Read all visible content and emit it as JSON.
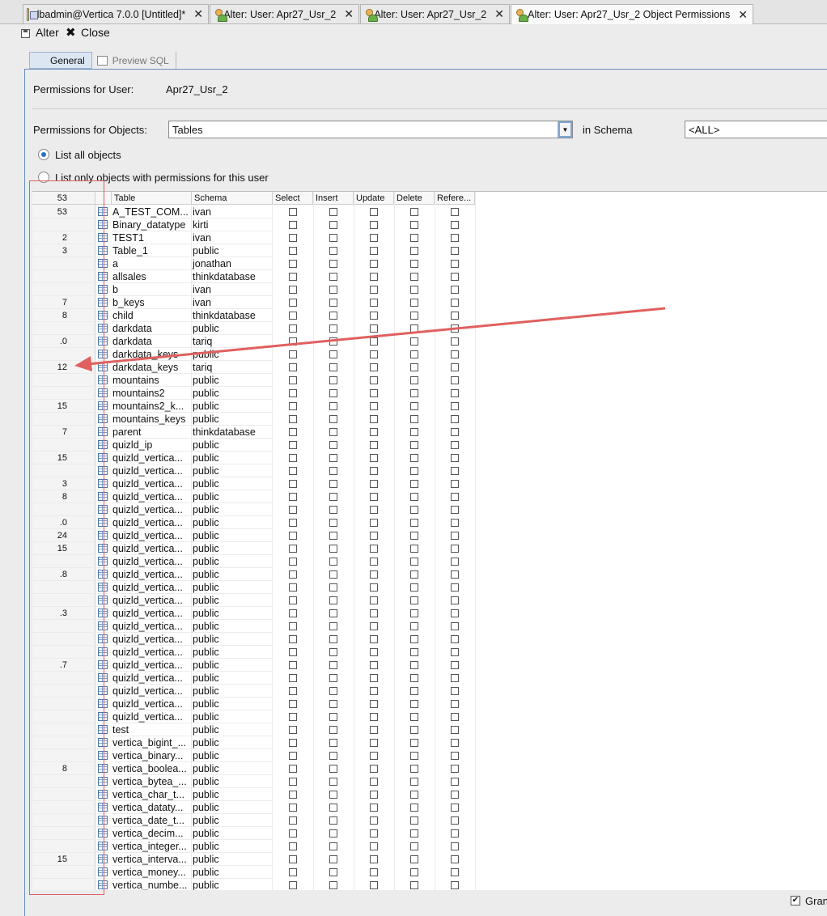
{
  "tabs": [
    {
      "label": "dbadmin@Vertica 7.0.0 [Untitled]*",
      "icon": "database-icon"
    },
    {
      "label": "Alter: User: Apr27_Usr_2",
      "icon": "user-icon"
    },
    {
      "label": "Alter: User: Apr27_Usr_2",
      "icon": "user-icon"
    },
    {
      "label": "Alter: User: Apr27_Usr_2 Object Permissions",
      "icon": "user-icon"
    }
  ],
  "toolbar": {
    "alter_label": "Alter",
    "close_label": "Close"
  },
  "subtabs": {
    "general": "General",
    "preview_sql": "Preview SQL"
  },
  "form": {
    "user_label": "Permissions for User:",
    "user_value": "Apr27_Usr_2",
    "objects_label": "Permissions for Objects:",
    "objects_value": "Tables",
    "in_schema_label": "in Schema",
    "schema_value": "<ALL>",
    "radio_all": "List all objects",
    "radio_only": "List only objects with permissions for this user"
  },
  "grid": {
    "columns": [
      "Table",
      "Schema",
      "Select",
      "Insert",
      "Update",
      "Delete",
      "Refere..."
    ],
    "header_rownum": "53",
    "rows": [
      {
        "num": "53",
        "table": "A_TEST_COM...",
        "schema": "ivan"
      },
      {
        "num": "",
        "table": "Binary_datatype",
        "schema": "kirti"
      },
      {
        "num": "2",
        "table": "TEST1",
        "schema": "ivan"
      },
      {
        "num": "3",
        "table": "Table_1",
        "schema": "public"
      },
      {
        "num": "",
        "table": "a",
        "schema": "jonathan"
      },
      {
        "num": "",
        "table": "allsales",
        "schema": "thinkdatabase"
      },
      {
        "num": "",
        "table": "b",
        "schema": "ivan"
      },
      {
        "num": "7",
        "table": "b_keys",
        "schema": "ivan"
      },
      {
        "num": "8",
        "table": "child",
        "schema": "thinkdatabase"
      },
      {
        "num": "",
        "table": "darkdata",
        "schema": "public"
      },
      {
        "num": ".0",
        "table": "darkdata",
        "schema": "tariq"
      },
      {
        "num": "",
        "table": "darkdata_keys",
        "schema": "public"
      },
      {
        "num": "12",
        "table": "darkdata_keys",
        "schema": "tariq"
      },
      {
        "num": "",
        "table": "mountains",
        "schema": "public"
      },
      {
        "num": "",
        "table": "mountains2",
        "schema": "public"
      },
      {
        "num": "15",
        "table": "mountains2_k...",
        "schema": "public"
      },
      {
        "num": "",
        "table": "mountains_keys",
        "schema": "public"
      },
      {
        "num": "7",
        "table": "parent",
        "schema": "thinkdatabase"
      },
      {
        "num": "",
        "table": "quizld_ip",
        "schema": "public"
      },
      {
        "num": "15",
        "table": "quizld_vertica...",
        "schema": "public"
      },
      {
        "num": "",
        "table": "quizld_vertica...",
        "schema": "public"
      },
      {
        "num": "3",
        "table": "quizld_vertica...",
        "schema": "public"
      },
      {
        "num": "8",
        "table": "quizld_vertica...",
        "schema": "public"
      },
      {
        "num": "",
        "table": "quizld_vertica...",
        "schema": "public"
      },
      {
        "num": ".0",
        "table": "quizld_vertica...",
        "schema": "public"
      },
      {
        "num": "24",
        "table": "quizld_vertica...",
        "schema": "public"
      },
      {
        "num": "15",
        "table": "quizld_vertica...",
        "schema": "public"
      },
      {
        "num": "",
        "table": "quizld_vertica...",
        "schema": "public"
      },
      {
        "num": ".8",
        "table": "quizld_vertica...",
        "schema": "public"
      },
      {
        "num": "",
        "table": "quizld_vertica...",
        "schema": "public"
      },
      {
        "num": "",
        "table": "quizld_vertica...",
        "schema": "public"
      },
      {
        "num": ".3",
        "table": "quizld_vertica...",
        "schema": "public"
      },
      {
        "num": "",
        "table": "quizld_vertica...",
        "schema": "public"
      },
      {
        "num": "",
        "table": "quizld_vertica...",
        "schema": "public"
      },
      {
        "num": "",
        "table": "quizld_vertica...",
        "schema": "public"
      },
      {
        "num": ".7",
        "table": "quizld_vertica...",
        "schema": "public"
      },
      {
        "num": "",
        "table": "quizld_vertica...",
        "schema": "public"
      },
      {
        "num": "",
        "table": "quizld_vertica...",
        "schema": "public"
      },
      {
        "num": "",
        "table": "quizld_vertica...",
        "schema": "public"
      },
      {
        "num": "",
        "table": "quizld_vertica...",
        "schema": "public"
      },
      {
        "num": "",
        "table": "test",
        "schema": "public"
      },
      {
        "num": "",
        "table": "vertica_bigint_...",
        "schema": "public"
      },
      {
        "num": "",
        "table": "vertica_binary...",
        "schema": "public"
      },
      {
        "num": "8",
        "table": "vertica_boolea...",
        "schema": "public"
      },
      {
        "num": "",
        "table": "vertica_bytea_...",
        "schema": "public"
      },
      {
        "num": "",
        "table": "vertica_char_t...",
        "schema": "public"
      },
      {
        "num": "",
        "table": "vertica_dataty...",
        "schema": "public"
      },
      {
        "num": "",
        "table": "vertica_date_t...",
        "schema": "public"
      },
      {
        "num": "",
        "table": "vertica_decim...",
        "schema": "public"
      },
      {
        "num": "",
        "table": "vertica_integer...",
        "schema": "public"
      },
      {
        "num": "15",
        "table": "vertica_interva...",
        "schema": "public"
      },
      {
        "num": "",
        "table": "vertica_money...",
        "schema": "public"
      },
      {
        "num": "",
        "table": "vertica_numbe...",
        "schema": "public"
      }
    ]
  },
  "bottom": {
    "grant_label": "Gran"
  },
  "colors": {
    "annotation": "#e06060",
    "focus": "#7fa8d8"
  }
}
